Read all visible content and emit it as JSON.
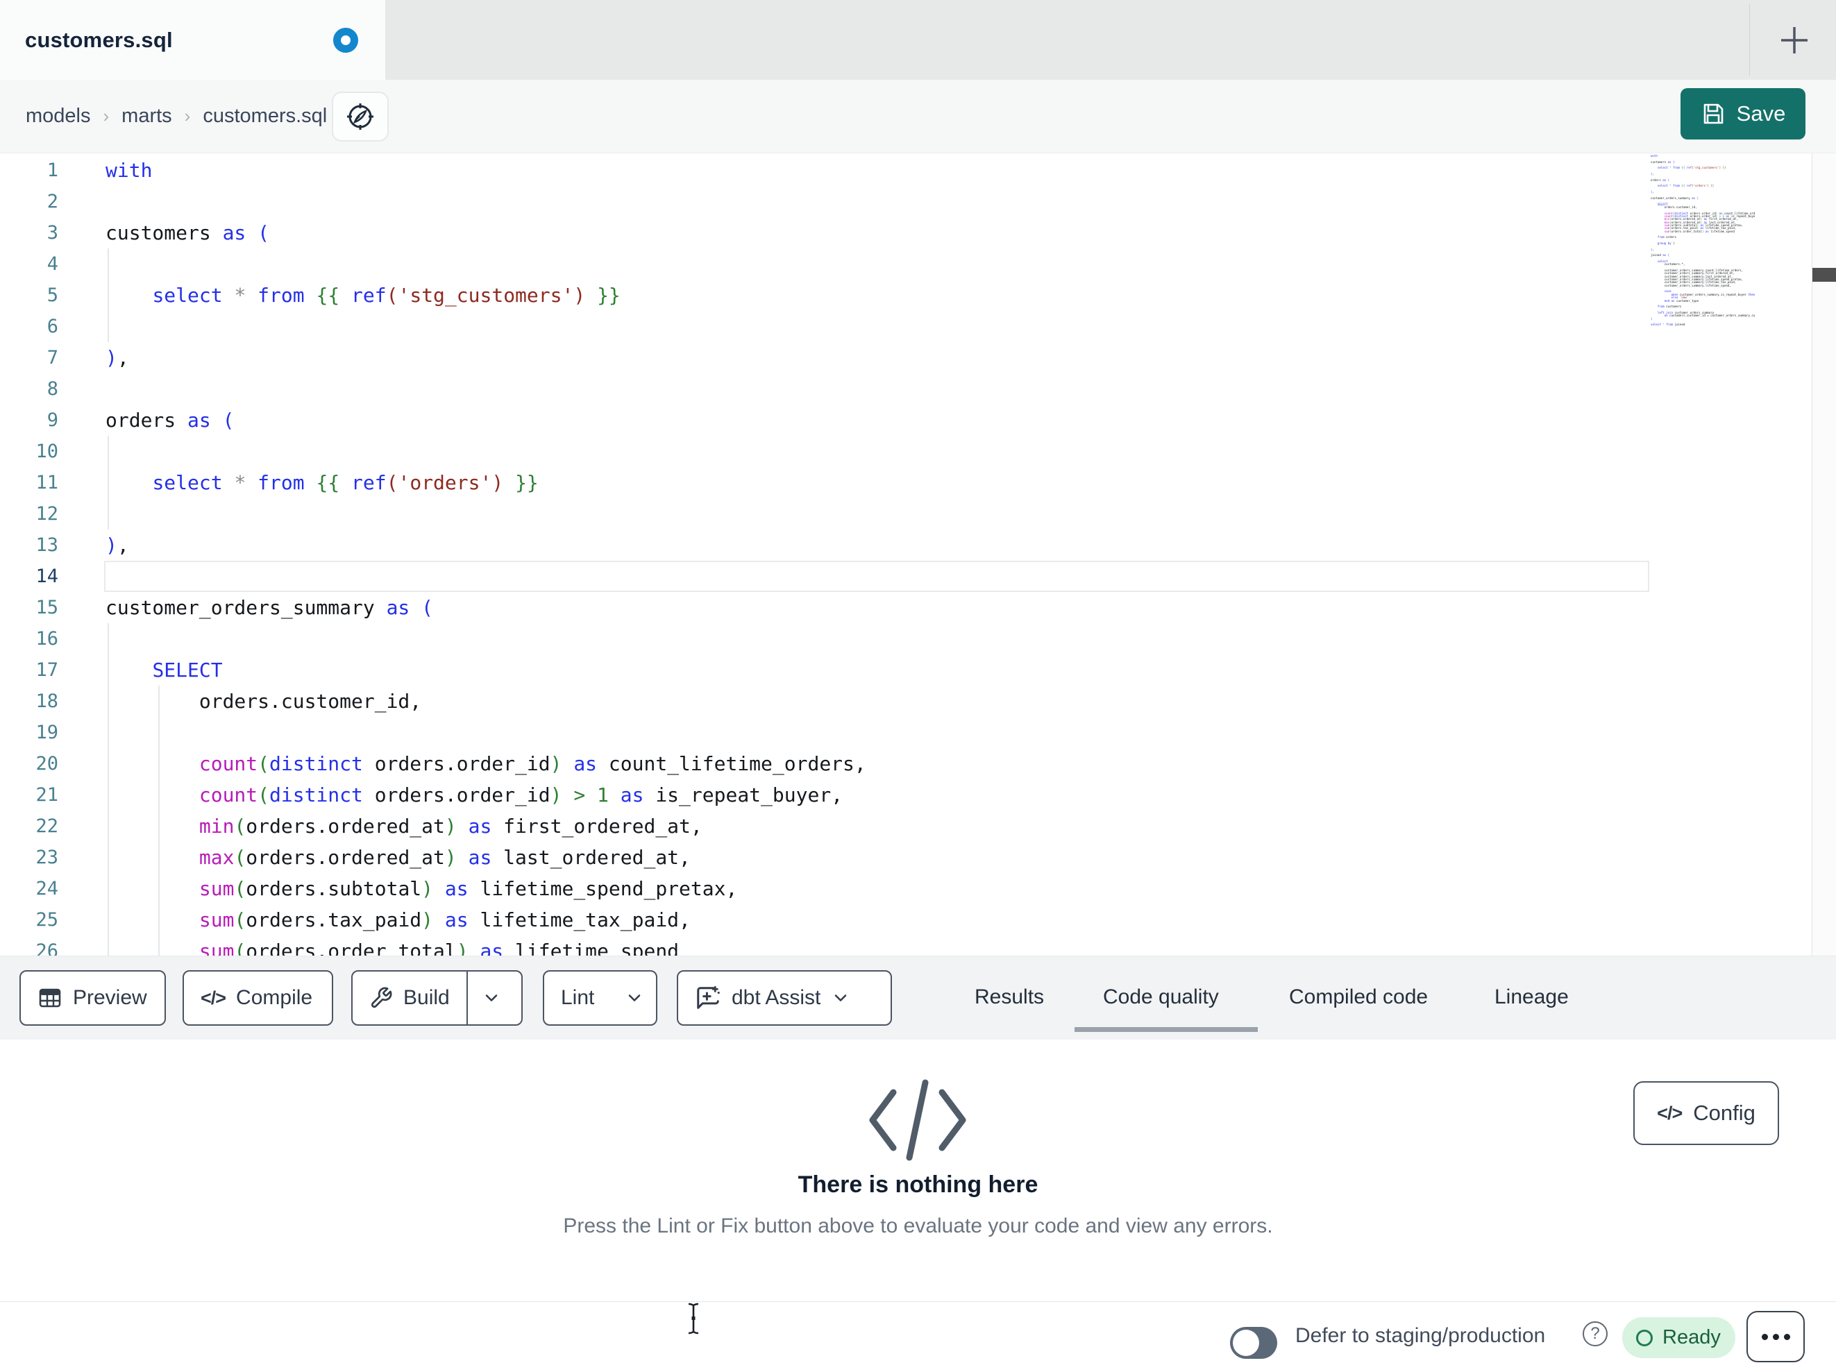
{
  "tabbar": {
    "tab_title": "customers.sql"
  },
  "breadcrumb": {
    "items": [
      "models",
      "marts",
      "customers.sql"
    ],
    "separator": "›"
  },
  "save": {
    "label": "Save"
  },
  "editor": {
    "active_line": 14,
    "lines": [
      [
        [
          "k",
          "with"
        ]
      ],
      [],
      [
        [
          "t",
          "customers "
        ],
        [
          "k",
          "as"
        ],
        [
          "t",
          " "
        ],
        [
          "b",
          "("
        ]
      ],
      [],
      [
        [
          "t",
          "    "
        ],
        [
          "k",
          "select"
        ],
        [
          "t",
          " "
        ],
        [
          "o",
          "*"
        ],
        [
          "t",
          " "
        ],
        [
          "k",
          "from"
        ],
        [
          "t",
          " "
        ],
        [
          "p",
          "{{"
        ],
        [
          "t",
          " "
        ],
        [
          "k",
          "ref"
        ],
        [
          "s",
          "('stg_customers')"
        ],
        [
          "t",
          " "
        ],
        [
          "p",
          "}}"
        ]
      ],
      [],
      [
        [
          "b",
          ")"
        ],
        [
          "t",
          ","
        ]
      ],
      [],
      [
        [
          "t",
          "orders "
        ],
        [
          "k",
          "as"
        ],
        [
          "t",
          " "
        ],
        [
          "b",
          "("
        ]
      ],
      [],
      [
        [
          "t",
          "    "
        ],
        [
          "k",
          "select"
        ],
        [
          "t",
          " "
        ],
        [
          "o",
          "*"
        ],
        [
          "t",
          " "
        ],
        [
          "k",
          "from"
        ],
        [
          "t",
          " "
        ],
        [
          "p",
          "{{"
        ],
        [
          "t",
          " "
        ],
        [
          "k",
          "ref"
        ],
        [
          "s",
          "('orders')"
        ],
        [
          "t",
          " "
        ],
        [
          "p",
          "}}"
        ]
      ],
      [],
      [
        [
          "b",
          ")"
        ],
        [
          "t",
          ","
        ]
      ],
      [],
      [
        [
          "t",
          "customer_orders_summary "
        ],
        [
          "k",
          "as"
        ],
        [
          "t",
          " "
        ],
        [
          "b",
          "("
        ]
      ],
      [],
      [
        [
          "t",
          "    "
        ],
        [
          "k",
          "SELECT"
        ]
      ],
      [
        [
          "t",
          "        orders.customer_id,"
        ]
      ],
      [],
      [
        [
          "t",
          "        "
        ],
        [
          "f",
          "count"
        ],
        [
          "p",
          "("
        ],
        [
          "k",
          "distinct"
        ],
        [
          "t",
          " orders.order_id"
        ],
        [
          "p",
          ")"
        ],
        [
          "t",
          " "
        ],
        [
          "k",
          "as"
        ],
        [
          "t",
          " count_lifetime_orders,"
        ]
      ],
      [
        [
          "t",
          "        "
        ],
        [
          "f",
          "count"
        ],
        [
          "p",
          "("
        ],
        [
          "k",
          "distinct"
        ],
        [
          "t",
          " orders.order_id"
        ],
        [
          "p",
          ")"
        ],
        [
          "t",
          " "
        ],
        [
          "p",
          ">"
        ],
        [
          "t",
          " "
        ],
        [
          "n",
          "1"
        ],
        [
          "t",
          " "
        ],
        [
          "k",
          "as"
        ],
        [
          "t",
          " is_repeat_buyer,"
        ]
      ],
      [
        [
          "t",
          "        "
        ],
        [
          "f",
          "min"
        ],
        [
          "p",
          "("
        ],
        [
          "t",
          "orders.ordered_at"
        ],
        [
          "p",
          ")"
        ],
        [
          "t",
          " "
        ],
        [
          "k",
          "as"
        ],
        [
          "t",
          " first_ordered_at,"
        ]
      ],
      [
        [
          "t",
          "        "
        ],
        [
          "f",
          "max"
        ],
        [
          "p",
          "("
        ],
        [
          "t",
          "orders.ordered_at"
        ],
        [
          "p",
          ")"
        ],
        [
          "t",
          " "
        ],
        [
          "k",
          "as"
        ],
        [
          "t",
          " last_ordered_at,"
        ]
      ],
      [
        [
          "t",
          "        "
        ],
        [
          "f",
          "sum"
        ],
        [
          "p",
          "("
        ],
        [
          "t",
          "orders.subtotal"
        ],
        [
          "p",
          ")"
        ],
        [
          "t",
          " "
        ],
        [
          "k",
          "as"
        ],
        [
          "t",
          " lifetime_spend_pretax,"
        ]
      ],
      [
        [
          "t",
          "        "
        ],
        [
          "f",
          "sum"
        ],
        [
          "p",
          "("
        ],
        [
          "t",
          "orders.tax_paid"
        ],
        [
          "p",
          ")"
        ],
        [
          "t",
          " "
        ],
        [
          "k",
          "as"
        ],
        [
          "t",
          " lifetime_tax_paid,"
        ]
      ],
      [
        [
          "t",
          "        "
        ],
        [
          "f",
          "sum"
        ],
        [
          "p",
          "("
        ],
        [
          "t",
          "orders.order_total"
        ],
        [
          "p",
          ")"
        ],
        [
          "t",
          " "
        ],
        [
          "k",
          "as"
        ],
        [
          "t",
          " lifetime_spend"
        ]
      ]
    ],
    "minimap_extra": [
      [],
      [
        [
          "t",
          "    "
        ],
        [
          "k",
          "from"
        ],
        [
          "t",
          " orders"
        ]
      ],
      [],
      [
        [
          "t",
          "    "
        ],
        [
          "k",
          "group"
        ],
        [
          "t",
          " "
        ],
        [
          "k",
          "by"
        ],
        [
          "t",
          " "
        ],
        [
          "n",
          "1"
        ]
      ],
      [],
      [
        [
          "b",
          ")"
        ],
        [
          "t",
          ","
        ]
      ],
      [],
      [
        [
          "t",
          "joined "
        ],
        [
          "k",
          "as"
        ],
        [
          "t",
          " "
        ],
        [
          "b",
          "("
        ]
      ],
      [],
      [
        [
          "t",
          "    "
        ],
        [
          "k",
          "select"
        ]
      ],
      [
        [
          "t",
          "        customers.*,"
        ]
      ],
      [],
      [
        [
          "t",
          "        customer_orders_summary.count_lifetime_orders,"
        ]
      ],
      [
        [
          "t",
          "        customer_orders_summary.first_ordered_at,"
        ]
      ],
      [
        [
          "t",
          "        customer_orders_summary.last_ordered_at,"
        ]
      ],
      [
        [
          "t",
          "        customer_orders_summary.lifetime_spend_pretax,"
        ]
      ],
      [
        [
          "t",
          "        customer_orders_summary.lifetime_tax_paid,"
        ]
      ],
      [
        [
          "t",
          "        customer_orders_summary.lifetime_spend,"
        ]
      ],
      [],
      [
        [
          "t",
          "        "
        ],
        [
          "k",
          "case"
        ]
      ],
      [
        [
          "t",
          "            "
        ],
        [
          "k",
          "when"
        ],
        [
          "t",
          " customer_orders_summary.is_repeat_buyer "
        ],
        [
          "k",
          "then"
        ],
        [
          "t",
          " "
        ],
        [
          "s",
          "'returning'"
        ]
      ],
      [
        [
          "t",
          "            "
        ],
        [
          "k",
          "else"
        ],
        [
          "t",
          " "
        ],
        [
          "s",
          "'new'"
        ]
      ],
      [
        [
          "t",
          "        "
        ],
        [
          "k",
          "end"
        ],
        [
          "t",
          " "
        ],
        [
          "k",
          "as"
        ],
        [
          "t",
          " customer_type"
        ]
      ],
      [],
      [
        [
          "t",
          "    "
        ],
        [
          "k",
          "from"
        ],
        [
          "t",
          " customers"
        ]
      ],
      [],
      [
        [
          "t",
          "    "
        ],
        [
          "k",
          "left"
        ],
        [
          "t",
          " "
        ],
        [
          "k",
          "join"
        ],
        [
          "t",
          " customer_orders_summary"
        ]
      ],
      [
        [
          "t",
          "        "
        ],
        [
          "k",
          "on"
        ],
        [
          "t",
          " customers.customer_id = customer_orders_summary.customer_id"
        ]
      ],
      [
        [
          "b",
          ")"
        ]
      ],
      [],
      [
        [
          "k",
          "select"
        ],
        [
          "t",
          " "
        ],
        [
          "o",
          "*"
        ],
        [
          "t",
          " "
        ],
        [
          "k",
          "from"
        ],
        [
          "t",
          " joined"
        ]
      ]
    ]
  },
  "toolbar": {
    "preview_label": "Preview",
    "compile_label": "Compile",
    "build_label": "Build",
    "lint_label": "Lint",
    "assist_label": "dbt Assist",
    "compile_icon": "</>"
  },
  "panel_tabs": {
    "items": [
      "Results",
      "Code quality",
      "Compiled code",
      "Lineage"
    ],
    "active": "Code quality"
  },
  "empty_state": {
    "title": "There is nothing here",
    "subtitle": "Press the Lint or Fix button above to evaluate your code and view any errors."
  },
  "config": {
    "label": "Config",
    "icon": "</>"
  },
  "statusbar": {
    "defer_label": "Defer to staging/production",
    "help_glyph": "?",
    "ready_label": "Ready"
  },
  "colors": {
    "accent_teal": "#14716a",
    "unsaved_dot_blue": "#1287cd",
    "keyword_blue": "#2430e8",
    "function_magenta": "#b81cb8",
    "string_red": "#8e2a21",
    "paren_green": "#2e8033",
    "line_number_teal": "#49808f",
    "ready_green_bg": "#d8f3e0",
    "ready_green_text": "#19603f"
  }
}
